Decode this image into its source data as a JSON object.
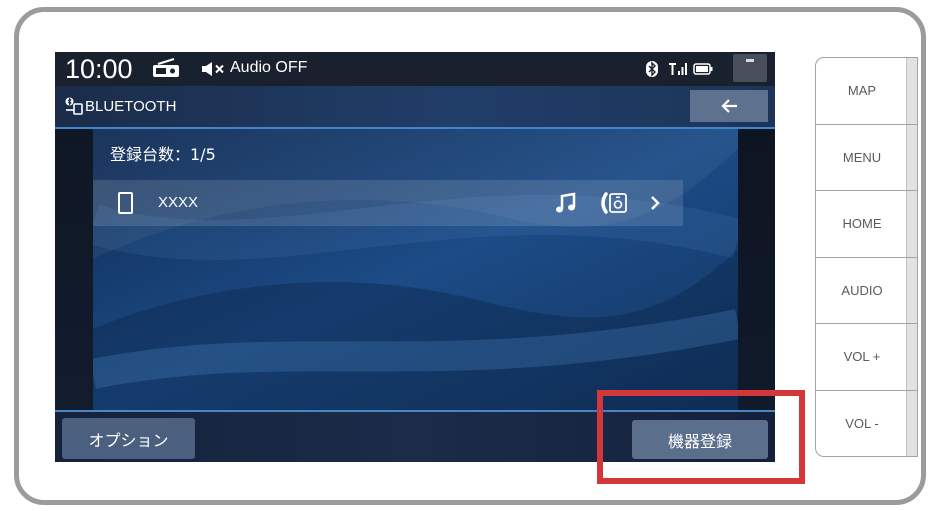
{
  "status_bar": {
    "time": "10:00",
    "source_icon": "radio-icon",
    "mute_icon": "speaker-mute-icon",
    "audio_status": "Audio OFF",
    "bluetooth_icon": "bluetooth-icon",
    "signal_icon": "signal-icon",
    "battery_icon": "battery-icon",
    "menu_icon": "status-menu-icon"
  },
  "header": {
    "icon": "bluetooth-phone-icon",
    "title": "BLUETOOTH",
    "back_icon": "back-arrow-icon"
  },
  "main": {
    "registered_count_label": "登録台数：1/5",
    "devices": [
      {
        "icon": "phone-icon",
        "name": "XXXX",
        "profile_icons": [
          "music-note-icon",
          "phone-speaker-icon"
        ],
        "detail_icon": "chevron-right-icon"
      }
    ]
  },
  "footer": {
    "option_label": "オプション",
    "register_label": "機器登録"
  },
  "hardware_buttons": [
    "MAP",
    "MENU",
    "HOME",
    "AUDIO",
    "VOL +",
    "VOL -"
  ],
  "colors": {
    "highlight": "#d4373a",
    "accent_line": "#3f86cf",
    "button_bg": "#5b6e8c",
    "screen_bg": "#111a28"
  }
}
